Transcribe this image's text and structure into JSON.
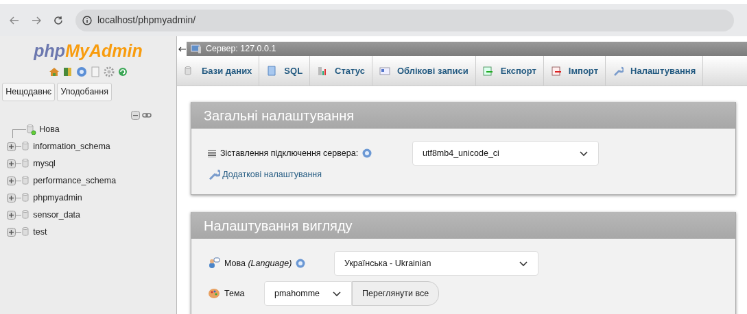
{
  "browser": {
    "url": "localhost/phpmyadmin/"
  },
  "logo": {
    "php": "php",
    "myadmin": "MyAdmin"
  },
  "sidebar": {
    "tabs": [
      {
        "label": "Нещодавнє"
      },
      {
        "label": "Уподобання"
      }
    ],
    "tree": [
      {
        "kind": "new",
        "label": "Нова"
      },
      {
        "kind": "database",
        "label": "information_schema",
        "expanded": false
      },
      {
        "kind": "database",
        "label": "mysql",
        "expanded": false
      },
      {
        "kind": "database",
        "label": "performance_schema",
        "expanded": false
      },
      {
        "kind": "database",
        "label": "phpmyadmin",
        "expanded": false
      },
      {
        "kind": "database",
        "label": "sensor_data",
        "expanded": false
      },
      {
        "kind": "database",
        "label": "test",
        "expanded": false
      }
    ]
  },
  "server_bar": {
    "label": "Сервер: 127.0.0.1"
  },
  "tabs": [
    {
      "kind": "databases",
      "label": "Бази даних"
    },
    {
      "kind": "sql",
      "label": "SQL"
    },
    {
      "kind": "status",
      "label": "Статус"
    },
    {
      "kind": "accounts",
      "label": "Облікові записи"
    },
    {
      "kind": "export",
      "label": "Експорт"
    },
    {
      "kind": "import",
      "label": "Імпорт"
    },
    {
      "kind": "settings",
      "label": "Налаштування"
    }
  ],
  "panels": [
    {
      "title": "Загальні налаштування",
      "rows": [
        {
          "kind": "collation",
          "label": "Зіставлення підключення сервера:",
          "value": "utf8mb4_unicode_ci"
        },
        {
          "kind": "link",
          "label": "Додаткові налаштування"
        }
      ]
    },
    {
      "title": "Налаштування вигляду",
      "rows": [
        {
          "kind": "language",
          "label": "Мова *(Language)*",
          "value": "Українська - Ukrainian"
        },
        {
          "kind": "theme",
          "label": "Тема",
          "value": "pmahomme",
          "button": "Переглянути все"
        }
      ]
    }
  ]
}
